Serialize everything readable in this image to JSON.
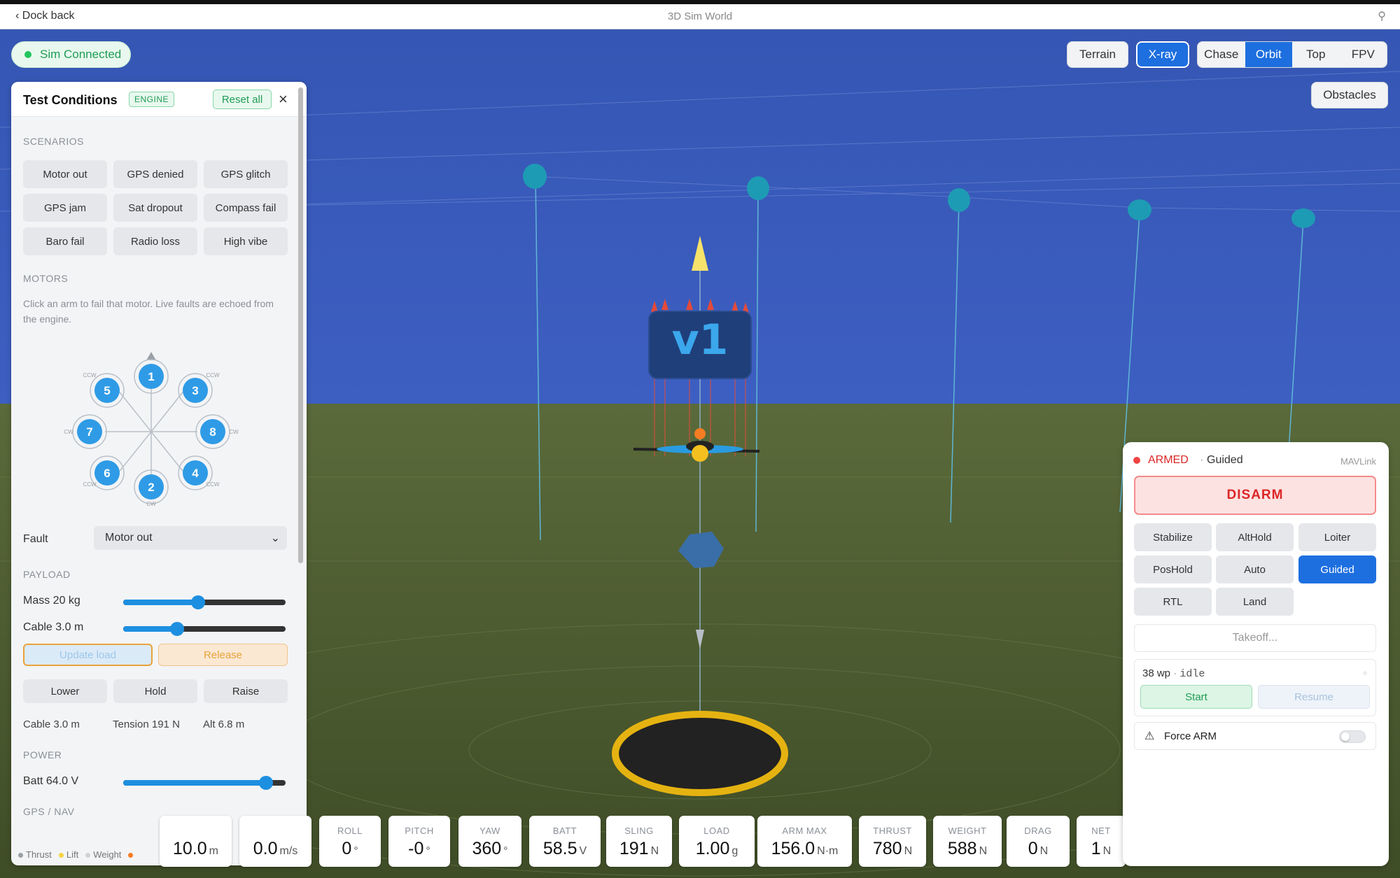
{
  "topbar": {
    "back_label": "Dock back",
    "title": "3D Sim World"
  },
  "status": {
    "connection": "Sim Connected"
  },
  "view_toggles": {
    "terrain": "Terrain",
    "xray": "X-ray",
    "obstacles": "Obstacles"
  },
  "camera": {
    "modes": [
      "Chase",
      "Orbit",
      "Top",
      "FPV"
    ],
    "active": "Orbit"
  },
  "scene": {
    "vehicle_label": "v1"
  },
  "panel": {
    "title": "Test Conditions",
    "badge": "ENGINE",
    "reset_label": "Reset all",
    "scenarios_label": "SCENARIOS",
    "scenarios": [
      "Motor out",
      "GPS denied",
      "GPS glitch",
      "GPS jam",
      "Sat dropout",
      "Compass fail",
      "Baro fail",
      "Radio loss",
      "High vibe"
    ],
    "motors_label": "MOTORS",
    "motors_hint": "Click an arm to fail that motor. Live faults are echoed from the engine.",
    "motors": [
      {
        "id": "1",
        "dir": ""
      },
      {
        "id": "2",
        "dir": "CW"
      },
      {
        "id": "3",
        "dir": "CCW"
      },
      {
        "id": "4",
        "dir": "CCW"
      },
      {
        "id": "5",
        "dir": "CCW"
      },
      {
        "id": "6",
        "dir": "CCW"
      },
      {
        "id": "7",
        "dir": "CW"
      },
      {
        "id": "8",
        "dir": "CW"
      }
    ],
    "fault_label": "Fault",
    "fault_value": "Motor out",
    "payload_label": "PAYLOAD",
    "mass_label": "Mass 20 kg",
    "mass_fraction": 0.46,
    "cable_label": "Cable 3.0 m",
    "cable_fraction": 0.33,
    "update_load": "Update load",
    "release": "Release",
    "load_buttons": [
      "Lower",
      "Hold",
      "Raise"
    ],
    "readouts": [
      "Cable 3.0 m",
      "Tension 191 N",
      "Alt 6.8 m"
    ],
    "power_label": "POWER",
    "batt_label": "Batt 64.0 V",
    "batt_fraction": 0.88,
    "gps_label": "GPS / NAV"
  },
  "legend": [
    "Thrust",
    "Lift",
    "Weight"
  ],
  "legend_colors": [
    "#9aa0a6",
    "#f5d442",
    "#cfd3d8"
  ],
  "telemetry": [
    {
      "label": "",
      "value": "10.0",
      "unit": "m"
    },
    {
      "label": "",
      "value": "0.0",
      "unit": "m/s"
    },
    {
      "label": "ROLL",
      "value": "0",
      "unit": "°"
    },
    {
      "label": "PITCH",
      "value": "-0",
      "unit": "°"
    },
    {
      "label": "YAW",
      "value": "360",
      "unit": "°"
    },
    {
      "label": "BATT",
      "value": "58.5",
      "unit": "V"
    },
    {
      "label": "SLING",
      "value": "191",
      "unit": "N"
    },
    {
      "label": "LOAD",
      "value": "1.00",
      "unit": "g"
    },
    {
      "label": "ARM MAX",
      "value": "156.0",
      "unit": "N·m"
    },
    {
      "label": "THRUST",
      "value": "780",
      "unit": "N"
    },
    {
      "label": "WEIGHT",
      "value": "588",
      "unit": "N"
    },
    {
      "label": "DRAG",
      "value": "0",
      "unit": "N"
    },
    {
      "label": "NET",
      "value": "1",
      "unit": "N"
    }
  ],
  "flight": {
    "armed_label": "ARMED",
    "separator": "·",
    "mode": "Guided",
    "link": "MAVLink",
    "disarm_label": "DISARM",
    "modes": [
      "Stabilize",
      "AltHold",
      "Loiter",
      "PosHold",
      "Auto",
      "Guided",
      "RTL",
      "Land"
    ],
    "active_mode": "Guided",
    "takeoff_label": "Takeoff...",
    "mission_count": "38 wp",
    "mission_sep": "·",
    "mission_state": "idle",
    "start_label": "Start",
    "resume_label": "Resume",
    "force_arm_label": "Force ARM",
    "force_arm_on": false
  },
  "colors": {
    "accent": "#1d6fe0",
    "armed": "#dc2626",
    "ok": "#1f9d55"
  }
}
